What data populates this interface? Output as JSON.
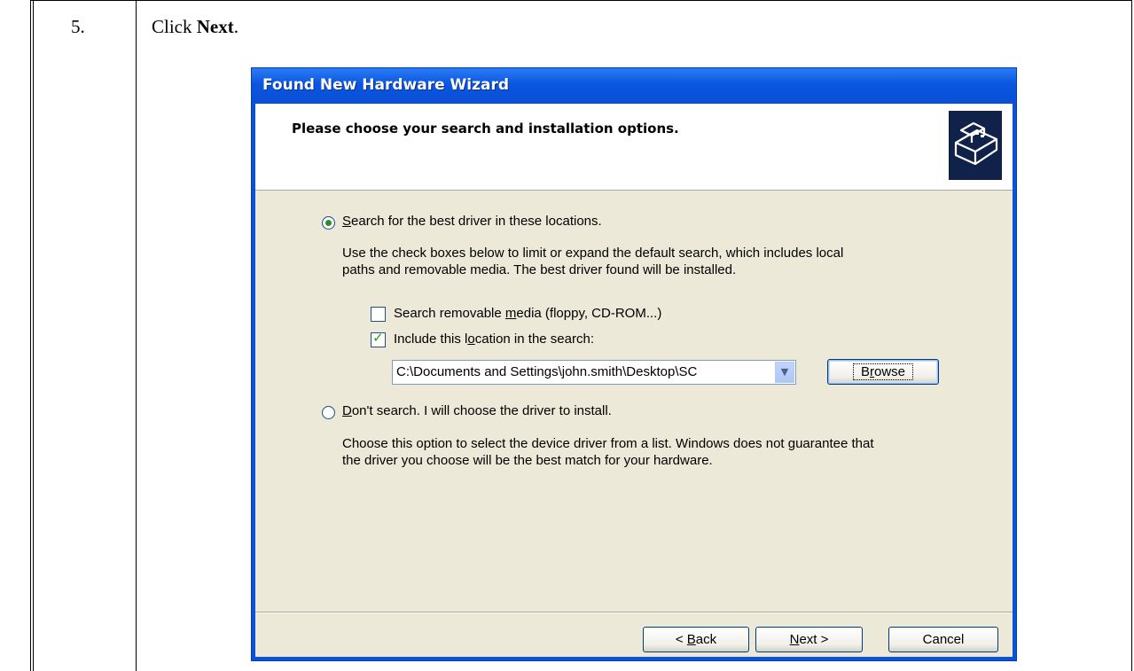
{
  "document": {
    "step_number": "5.",
    "instruction_prefix": "Click ",
    "instruction_bold": "Next",
    "instruction_suffix": "."
  },
  "wizard": {
    "title": "Found New Hardware Wizard",
    "heading": "Please choose your search and installation options.",
    "header_icon": "hardware-install-icon",
    "option_search": {
      "label_accel": "S",
      "label_rest": "earch for the best driver in these locations.",
      "selected": true,
      "description_line1": "Use the check boxes below to limit or expand the default search, which includes local",
      "description_line2": "paths and removable media. The best driver found will be installed."
    },
    "checkbox_removable": {
      "label_pre": "Search removable ",
      "label_accel": "m",
      "label_post": "edia (floppy, CD-ROM...)",
      "checked": false
    },
    "checkbox_location": {
      "label_pre": "Include this l",
      "label_accel": "o",
      "label_post": "cation in the search:",
      "checked": true
    },
    "location_value": "C:\\Documents and Settings\\john.smith\\Desktop\\SC",
    "browse_label_pre": "B",
    "browse_label_accel": "r",
    "browse_label_post": "owse",
    "option_dont_search": {
      "label_accel": "D",
      "label_rest": "on't search. I will choose the driver to install.",
      "selected": false,
      "description_line1": "Choose this option to select the device driver from a list.  Windows does not guarantee that",
      "description_line2": "the driver you choose will be the best match for your hardware."
    },
    "back_pre": "< ",
    "back_accel": "B",
    "back_post": "ack",
    "next_accel": "N",
    "next_post": "ext >",
    "cancel_label": "Cancel"
  }
}
